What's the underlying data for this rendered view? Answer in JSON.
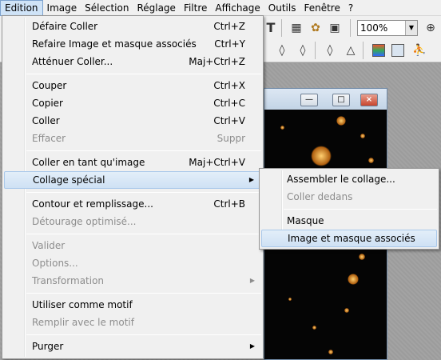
{
  "menubar": {
    "items": [
      "Edition",
      "Image",
      "Sélection",
      "Réglage",
      "Filtre",
      "Affichage",
      "Outils",
      "Fenêtre",
      "?"
    ]
  },
  "toolbar": {
    "zoom_value": "100%",
    "icons": [
      "text-tool-icon",
      "layers-icon",
      "settings-icon",
      "window-icon",
      "zoom-icon",
      "color-palette-icon",
      "run-icon",
      "droplet-icon",
      "triangle-icon"
    ]
  },
  "document_window": {
    "buttons": {
      "minimize": "—",
      "maximize": "□",
      "close": "×"
    }
  },
  "edit_menu": {
    "items": [
      {
        "label": "Défaire Coller",
        "shortcut": "Ctrl+Z",
        "disabled": false
      },
      {
        "label": "Refaire Image et masque associés",
        "shortcut": "Ctrl+Y",
        "disabled": false
      },
      {
        "label": "Atténuer Coller...",
        "shortcut": "Maj+Ctrl+Z",
        "disabled": false
      },
      {
        "label": "Couper",
        "shortcut": "Ctrl+X",
        "disabled": false
      },
      {
        "label": "Copier",
        "shortcut": "Ctrl+C",
        "disabled": false
      },
      {
        "label": "Coller",
        "shortcut": "Ctrl+V",
        "disabled": false
      },
      {
        "label": "Effacer",
        "shortcut": "Suppr",
        "disabled": true
      },
      {
        "label": "Coller en tant qu'image",
        "shortcut": "Maj+Ctrl+V",
        "disabled": false
      },
      {
        "label": "Collage spécial",
        "shortcut": "",
        "disabled": false,
        "submenu": true,
        "highlighted": true
      },
      {
        "label": "Contour et remplissage...",
        "shortcut": "Ctrl+B",
        "disabled": false
      },
      {
        "label": "Détourage optimisé...",
        "shortcut": "",
        "disabled": true
      },
      {
        "label": "Valider",
        "shortcut": "",
        "disabled": true
      },
      {
        "label": "Options...",
        "shortcut": "",
        "disabled": true
      },
      {
        "label": "Transformation",
        "shortcut": "",
        "disabled": true,
        "submenu": true
      },
      {
        "label": "Utiliser comme motif",
        "shortcut": "",
        "disabled": false
      },
      {
        "label": "Remplir avec le motif",
        "shortcut": "",
        "disabled": true
      },
      {
        "label": "Purger",
        "shortcut": "",
        "disabled": false,
        "submenu": true
      }
    ]
  },
  "submenu": {
    "items": [
      {
        "label": "Assembler le collage...",
        "disabled": false
      },
      {
        "label": "Coller dedans",
        "disabled": true
      },
      {
        "label": "Masque",
        "disabled": false
      },
      {
        "label": "Image et masque associés",
        "disabled": false,
        "highlighted": true
      }
    ]
  },
  "colors": {
    "menu_bg": "#f0f0f0",
    "highlight": "#cfe1f4",
    "disabled_text": "#8d8d8d",
    "canvas_bg": "#050505",
    "star": "#ffb040"
  }
}
